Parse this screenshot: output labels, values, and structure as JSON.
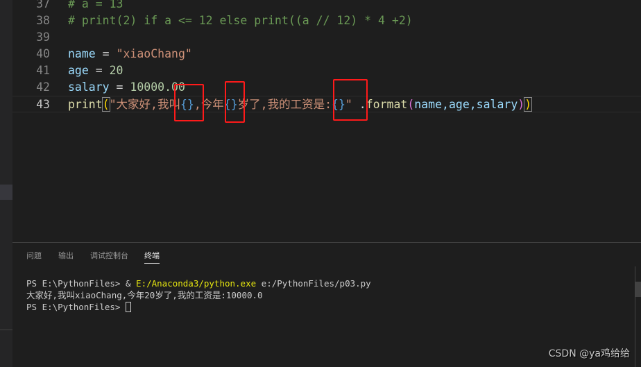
{
  "editor": {
    "lines": [
      {
        "num": "37",
        "text": "# a = 13"
      },
      {
        "num": "38",
        "text": "# print(2) if a <= 12 else print((a // 12) * 4 +2)"
      },
      {
        "num": "39",
        "text": ""
      },
      {
        "num": "40",
        "t1": "name",
        "t2": " = ",
        "t3": "\"xiaoChang\""
      },
      {
        "num": "41",
        "t1": "age",
        "t2": " = ",
        "t3": "20"
      },
      {
        "num": "42",
        "t1": "salary",
        "t2": " = ",
        "t3": "10000.00"
      },
      {
        "num": "43",
        "fn": "print",
        "lp": "(",
        "s1": "\"大家好,我叫",
        "b1": "{}",
        "s2": ",今年",
        "b2": "{}",
        "s3": "岁了,我的工资是:",
        "b3": "{}",
        "s4": "\"",
        "dot": " .",
        "method": "format",
        "lp2": "(",
        "args": "name,age,salary",
        "rp2": ")",
        "rp": ")"
      }
    ]
  },
  "panel": {
    "tabs": [
      {
        "label": "问题"
      },
      {
        "label": "输出"
      },
      {
        "label": "调试控制台"
      },
      {
        "label": "终端",
        "active": true
      }
    ],
    "terminal": {
      "line1_prompt": "PS E:\\PythonFiles> & ",
      "line1_exe": "E:/Anaconda3/python.exe",
      "line1_arg": " e:/PythonFiles/p03.py",
      "line2": "大家好,我叫xiaoChang,今年20岁了,我的工资是:10000.0",
      "line3_prompt": "PS E:\\PythonFiles> "
    }
  },
  "watermark": "CSDN @ya鸡给给",
  "colors": {
    "annotation_box": "#ff1a1a",
    "background": "#1e1e1e"
  }
}
